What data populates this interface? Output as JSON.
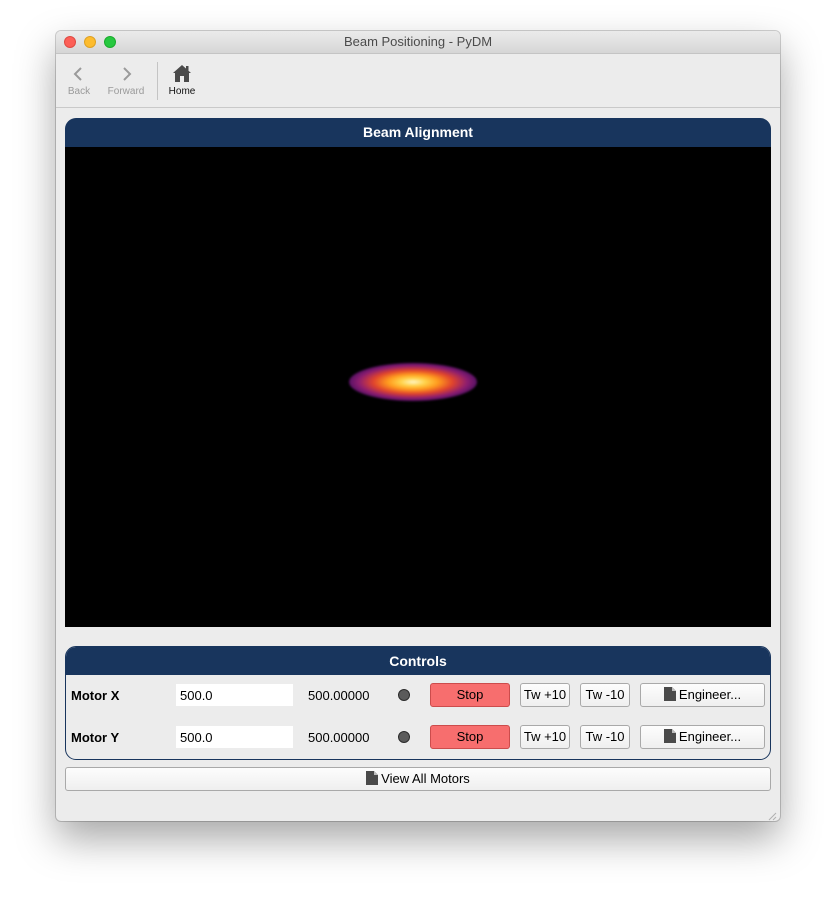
{
  "window": {
    "title": "Beam Positioning - PyDM"
  },
  "toolbar": {
    "back_label": "Back",
    "forward_label": "Forward",
    "home_label": "Home"
  },
  "beam_panel": {
    "title": "Beam Alignment"
  },
  "controls_panel": {
    "title": "Controls",
    "motors": [
      {
        "name": "Motor X",
        "setpoint": "500.0",
        "readback": "500.00000",
        "stop_label": "Stop",
        "tweak_plus_label": "Tw +10",
        "tweak_minus_label": "Tw -10",
        "engineer_label": "Engineer..."
      },
      {
        "name": "Motor Y",
        "setpoint": "500.0",
        "readback": "500.00000",
        "stop_label": "Stop",
        "tweak_plus_label": "Tw +10",
        "tweak_minus_label": "Tw -10",
        "engineer_label": "Engineer..."
      }
    ]
  },
  "view_all_label": "View All Motors",
  "icons": {
    "back": "chevron-left-icon",
    "forward": "chevron-right-icon",
    "home": "home-icon",
    "engineer": "document-icon",
    "view_all": "document-icon",
    "led": "status-led-icon"
  },
  "colors": {
    "panel_header": "#18355d",
    "stop_button": "#f76e6e",
    "led": "#5b5b5b",
    "image_background": "#000000"
  }
}
